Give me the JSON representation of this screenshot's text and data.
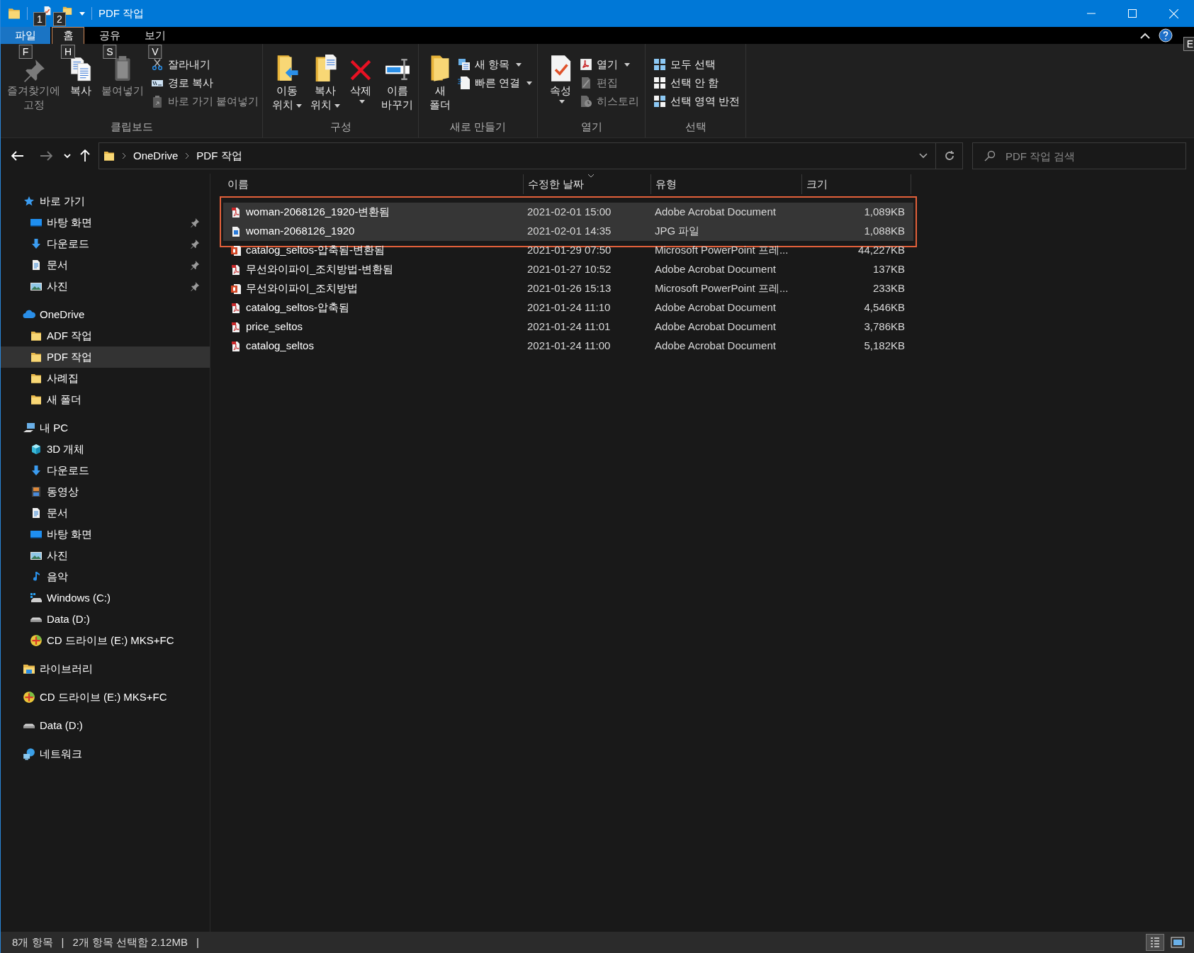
{
  "window": {
    "title": "PDF 작업",
    "keytips": [
      "1",
      "2"
    ]
  },
  "ribbon_tabs": [
    {
      "label": "파일",
      "kind": "file",
      "keytip": "F",
      "selected": false
    },
    {
      "label": "홈",
      "kind": "tab",
      "keytip": "H",
      "selected": true
    },
    {
      "label": "공유",
      "kind": "tab",
      "keytip": "S",
      "selected": false
    },
    {
      "label": "보기",
      "kind": "tab",
      "keytip": "V",
      "selected": false
    }
  ],
  "help_keytip": "E",
  "ribbon_groups": [
    {
      "label": "클립보드",
      "items": [
        {
          "label": "즐겨찾기에\n고정",
          "kind": "large",
          "disabled": true,
          "has_menu": false
        },
        {
          "label": "복사",
          "kind": "large",
          "disabled": false,
          "has_menu": false
        },
        {
          "label": "붙여넣기",
          "kind": "large",
          "disabled": true,
          "has_menu": false
        },
        {
          "label": "잘라내기",
          "kind": "small",
          "disabled": false,
          "has_menu": false
        },
        {
          "label": "경로 복사",
          "kind": "small",
          "disabled": false,
          "has_menu": false
        },
        {
          "label": "바로 가기 붙여넣기",
          "kind": "small",
          "disabled": true,
          "has_menu": false
        }
      ]
    },
    {
      "label": "구성",
      "items": [
        {
          "label": "이동\n위치",
          "kind": "large",
          "disabled": false,
          "has_menu": true
        },
        {
          "label": "복사\n위치",
          "kind": "large",
          "disabled": false,
          "has_menu": true
        },
        {
          "label": "삭제",
          "kind": "large",
          "disabled": false,
          "has_menu": true
        },
        {
          "label": "이름\n바꾸기",
          "kind": "large",
          "disabled": false,
          "has_menu": false
        }
      ]
    },
    {
      "label": "새로 만들기",
      "items": [
        {
          "label": "새\n폴더",
          "kind": "large",
          "disabled": false,
          "has_menu": false
        },
        {
          "label": "새 항목",
          "kind": "small",
          "disabled": false,
          "has_menu": true
        },
        {
          "label": "빠른 연결",
          "kind": "small",
          "disabled": false,
          "has_menu": true
        }
      ]
    },
    {
      "label": "열기",
      "items": [
        {
          "label": "속성",
          "kind": "large",
          "disabled": false,
          "has_menu": true
        },
        {
          "label": "열기",
          "kind": "small",
          "disabled": false,
          "has_menu": true
        },
        {
          "label": "편집",
          "kind": "small",
          "disabled": true,
          "has_menu": false
        },
        {
          "label": "히스토리",
          "kind": "small",
          "disabled": true,
          "has_menu": false
        }
      ]
    },
    {
      "label": "선택",
      "items": [
        {
          "label": "모두 선택",
          "kind": "small",
          "disabled": false,
          "has_menu": false
        },
        {
          "label": "선택 안 함",
          "kind": "small",
          "disabled": false,
          "has_menu": false
        },
        {
          "label": "선택 영역 반전",
          "kind": "small",
          "disabled": false,
          "has_menu": false
        }
      ]
    }
  ],
  "nav_buttons": [
    {
      "kind": "back",
      "disabled": false
    },
    {
      "kind": "forward",
      "disabled": true
    },
    {
      "kind": "recent",
      "disabled": false
    },
    {
      "kind": "up",
      "disabled": false
    }
  ],
  "address": {
    "crumbs": [
      "OneDrive",
      "PDF 작업"
    ]
  },
  "search": {
    "placeholder": "PDF 작업 검색"
  },
  "navigation": [
    {
      "label": "바로 가기",
      "selected": false,
      "children": [
        {
          "label": "바탕 화면",
          "selected": false,
          "pinned": true
        },
        {
          "label": "다운로드",
          "selected": false,
          "pinned": true
        },
        {
          "label": "문서",
          "selected": false,
          "pinned": true
        },
        {
          "label": "사진",
          "selected": false,
          "pinned": true
        }
      ]
    },
    {
      "label": "OneDrive",
      "selected": false,
      "children": [
        {
          "label": "ADF 작업",
          "selected": false,
          "pinned": false
        },
        {
          "label": "PDF 작업",
          "selected": true,
          "pinned": false
        },
        {
          "label": "사례집",
          "selected": false,
          "pinned": false
        },
        {
          "label": "새 폴더",
          "selected": false,
          "pinned": false
        }
      ]
    },
    {
      "label": "내 PC",
      "selected": false,
      "children": [
        {
          "label": "3D 개체",
          "selected": false,
          "pinned": false
        },
        {
          "label": "다운로드",
          "selected": false,
          "pinned": false
        },
        {
          "label": "동영상",
          "selected": false,
          "pinned": false
        },
        {
          "label": "문서",
          "selected": false,
          "pinned": false
        },
        {
          "label": "바탕 화면",
          "selected": false,
          "pinned": false
        },
        {
          "label": "사진",
          "selected": false,
          "pinned": false
        },
        {
          "label": "음악",
          "selected": false,
          "pinned": false
        },
        {
          "label": "Windows (C:)",
          "selected": false,
          "pinned": false
        },
        {
          "label": "Data (D:)",
          "selected": false,
          "pinned": false
        },
        {
          "label": "CD 드라이브 (E:) MKS+FC",
          "selected": false,
          "pinned": false
        }
      ]
    },
    {
      "label": "라이브러리",
      "selected": false
    },
    {
      "label": "CD 드라이브 (E:) MKS+FC",
      "selected": false
    },
    {
      "label": "Data (D:)",
      "selected": false
    },
    {
      "label": "네트워크",
      "selected": false
    }
  ],
  "columns": [
    {
      "label": "이름",
      "sorted": false
    },
    {
      "label": "수정한 날짜",
      "sorted": true
    },
    {
      "label": "유형",
      "sorted": false
    },
    {
      "label": "크기",
      "sorted": false
    }
  ],
  "files": [
    {
      "kind": "pdf",
      "name": "woman-2068126_1920-변환됨",
      "date": "2021-02-01 15:00",
      "type": "Adobe Acrobat Document",
      "size": "1,089KB",
      "selected": true,
      "framed": true
    },
    {
      "kind": "jpg",
      "name": "woman-2068126_1920",
      "date": "2021-02-01 14:35",
      "type": "JPG 파일",
      "size": "1,088KB",
      "selected": true,
      "framed": true
    },
    {
      "kind": "ppt",
      "name": "catalog_seltos-압축됨-변환됨",
      "date": "2021-01-29 07:50",
      "type": "Microsoft PowerPoint 프레...",
      "size": "44,227KB",
      "selected": false,
      "framed": false
    },
    {
      "kind": "pdf",
      "name": "무선와이파이_조치방법-변환됨",
      "date": "2021-01-27 10:52",
      "type": "Adobe Acrobat Document",
      "size": "137KB",
      "selected": false,
      "framed": false
    },
    {
      "kind": "ppt",
      "name": "무선와이파이_조치방법",
      "date": "2021-01-26 15:13",
      "type": "Microsoft PowerPoint 프레...",
      "size": "233KB",
      "selected": false,
      "framed": false
    },
    {
      "kind": "pdf",
      "name": "catalog_seltos-압축됨",
      "date": "2021-01-24 11:10",
      "type": "Adobe Acrobat Document",
      "size": "4,546KB",
      "selected": false,
      "framed": false
    },
    {
      "kind": "pdf",
      "name": "price_seltos",
      "date": "2021-01-24 11:01",
      "type": "Adobe Acrobat Document",
      "size": "3,786KB",
      "selected": false,
      "framed": false
    },
    {
      "kind": "pdf",
      "name": "catalog_seltos",
      "date": "2021-01-24 11:00",
      "type": "Adobe Acrobat Document",
      "size": "5,182KB",
      "selected": false,
      "framed": false
    }
  ],
  "status_bar": {
    "texts": [
      "8개 항목",
      "|",
      "2개 항목 선택함 2.12MB",
      "|"
    ],
    "views": [
      {
        "kind": "details",
        "selected": true
      },
      {
        "kind": "large-icons",
        "selected": false
      }
    ]
  }
}
